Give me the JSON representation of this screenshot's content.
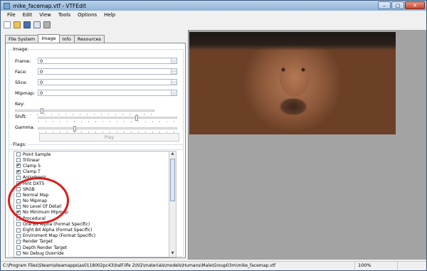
{
  "window": {
    "title": "mike_facemap.vtf - VTFEdit"
  },
  "window_buttons": {
    "minimize": "–",
    "maximize": "□",
    "close": "✕"
  },
  "menu": [
    "File",
    "Edit",
    "View",
    "Tools",
    "Options",
    "Help"
  ],
  "toolbar": {
    "icons": [
      "new-icon",
      "open-icon",
      "save-icon",
      "copy-icon",
      "paste-icon"
    ]
  },
  "tabs": [
    "File System",
    "Image",
    "Info",
    "Resources"
  ],
  "active_tab": "Image",
  "image_group": {
    "label": "Image:",
    "fields": [
      {
        "label": "Frame:",
        "value": "0"
      },
      {
        "label": "Face:",
        "value": "0"
      },
      {
        "label": "Slice:",
        "value": "0"
      },
      {
        "label": "Mipmap:",
        "value": "0"
      }
    ],
    "sliders": [
      {
        "label": "Key:",
        "level": 0.18
      },
      {
        "label": "Shift:",
        "level": 0.7
      },
      {
        "label": "Gamma:",
        "level": 0.25
      }
    ],
    "play_label": "Play"
  },
  "flags_group": {
    "label": "Flags:",
    "items": [
      {
        "label": "Point Sample",
        "checked": false
      },
      {
        "label": "Trilinear",
        "checked": false
      },
      {
        "label": "Clamp S",
        "checked": true
      },
      {
        "label": "Clamp T",
        "checked": true
      },
      {
        "label": "Anisotropic",
        "checked": false
      },
      {
        "label": "Hint DXT5",
        "checked": false
      },
      {
        "label": "SRGB",
        "checked": false
      },
      {
        "label": "Normal Map",
        "checked": false
      },
      {
        "label": "No Mipmap",
        "checked": false
      },
      {
        "label": "No Level Of Detail",
        "checked": false
      },
      {
        "label": "No Minimum Mipmap",
        "checked": true
      },
      {
        "label": "Procedural",
        "checked": false
      },
      {
        "label": "One Bit Alpha (Format Specific)",
        "checked": false
      },
      {
        "label": "Eight Bit Alpha (Format Specific)",
        "checked": false
      },
      {
        "label": "Enviroment Map (Format Specific)",
        "checked": false
      },
      {
        "label": "Render Target",
        "checked": false
      },
      {
        "label": "Depth Render Target",
        "checked": false
      },
      {
        "label": "No Debug Override",
        "checked": false
      }
    ]
  },
  "status": {
    "path": "C:\\Program Files\\Steam\\steamapps\\as0118002pc43\\half-life 2\\hl2\\materials\\models\\Humans\\Male\\Group03m\\mike_facemap.vtf",
    "zoom": "100%"
  },
  "colors": {
    "highlight": "#dc1b1b",
    "viewer_bg": "#a3a3a3"
  }
}
